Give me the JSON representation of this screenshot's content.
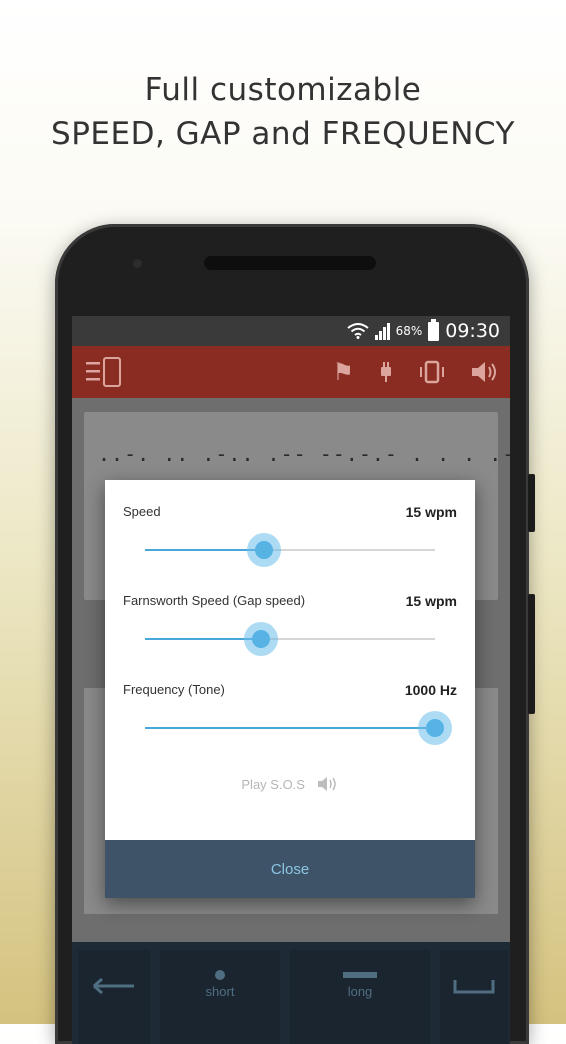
{
  "headline": {
    "line1": "Full customizable",
    "line2": "SPEED, GAP and FREQUENCY"
  },
  "status": {
    "battery": "68%",
    "time": "09:30"
  },
  "morse": "..-. .. .-.. .-- --.-.- . . . .-.. -- .- ... .-. ...",
  "dialog": {
    "rows": [
      {
        "label": "Speed",
        "value": "15 wpm",
        "fraction": 0.41
      },
      {
        "label": "Farnsworth Speed (Gap speed)",
        "value": "15 wpm",
        "fraction": 0.4
      },
      {
        "label": "Frequency (Tone)",
        "value": "1000 Hz",
        "fraction": 1.0
      }
    ],
    "play_label": "Play S.O.S",
    "close_label": "Close"
  },
  "keys": {
    "short": "short",
    "long": "long"
  },
  "icons": [
    "menu-icon",
    "phone-icon",
    "running-icon",
    "plug-icon",
    "vibrate-icon",
    "speaker-icon",
    "backspace-icon",
    "space-icon"
  ],
  "colors": {
    "toolbar": "#8a2c22",
    "accent": "#56b3e4",
    "close_bar": "#3e5367"
  }
}
